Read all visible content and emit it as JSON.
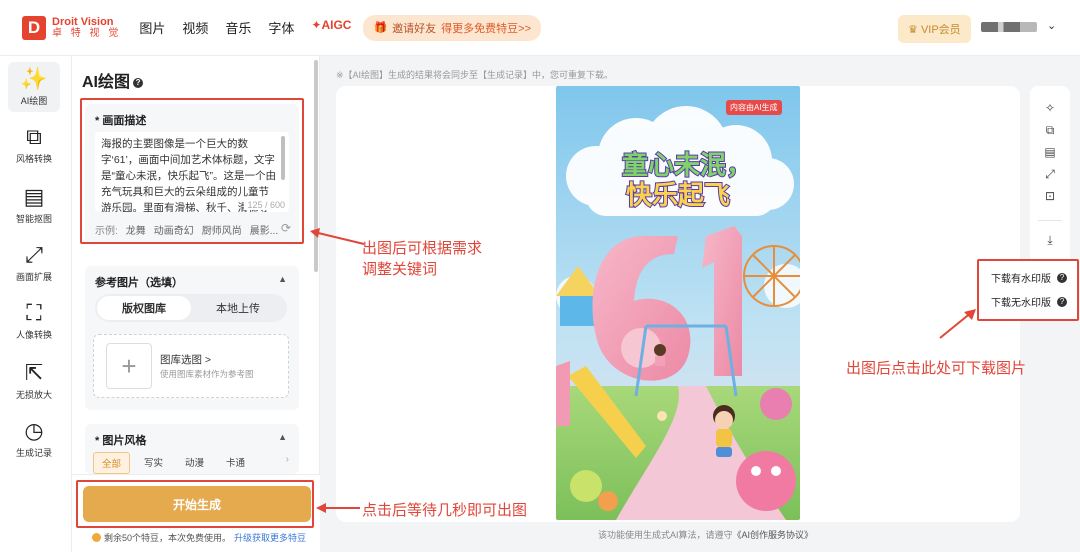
{
  "brand": {
    "en": "Droit Vision",
    "cn": "卓 特 视 觉"
  },
  "nav": {
    "items": [
      "图片",
      "视频",
      "音乐",
      "字体"
    ],
    "aigc": "AIGC"
  },
  "invite": {
    "label": "邀请好友",
    "highlight": "得更多免费特豆>>"
  },
  "account": {
    "vip": "VIP会员"
  },
  "sidebar": {
    "items": [
      {
        "label": "AI绘图",
        "icon": "magic-wand-icon"
      },
      {
        "label": "风格转换",
        "icon": "grid-shapes-icon"
      },
      {
        "label": "智能抠图",
        "icon": "layers-icon"
      },
      {
        "label": "画面扩展",
        "icon": "expand-icon"
      },
      {
        "label": "人像转换",
        "icon": "portrait-icon"
      },
      {
        "label": "无损放大",
        "icon": "upscale-icon"
      },
      {
        "label": "生成记录",
        "icon": "clock-icon"
      }
    ]
  },
  "panel": {
    "title": "AI绘图",
    "description": {
      "label": "* 画面描述",
      "text": "海报的主要图像是一个巨大的数字‘61’，画面中间加艺术体标题，文字是“童心未泯，快乐起飞”。这是一个由充气玩具和巨大的云朵组成的儿童节游乐园。里面有滑梯、秋千、滑梯等设施，",
      "count": "125 / 600",
      "examples_label": "示例:",
      "examples": [
        "龙舞",
        "动画奇幻",
        "厨师风尚",
        "晨影..."
      ]
    },
    "reference": {
      "label": "参考图片（选填）",
      "tabs": [
        "版权图库",
        "本地上传"
      ],
      "upload_title": "图库选图 >",
      "upload_sub": "使用图库素材作为参考图"
    },
    "style": {
      "label": "* 图片风格",
      "tabs": [
        "全部",
        "写实",
        "动漫",
        "卡通"
      ]
    },
    "generate": "开始生成",
    "remaining": "剩余50个特豆，本次免费使用。",
    "remaining_link": "升级获取更多特豆"
  },
  "main": {
    "notice": "※【AI绘图】生成的结果将会同步至【生成记录】中，您可重复下载。",
    "ai_badge": "内容由AI生成",
    "poster_title": [
      "童心未泯，",
      "快乐起飞"
    ],
    "poster_number": "61",
    "footer": "该功能使用生成式AI算法，请遵守",
    "footer_link": "《AI创作服务协议》",
    "download": [
      "下载有水印版",
      "下载无水印版"
    ]
  },
  "tools": [
    "magic-wand-icon",
    "grid-icon",
    "layers-icon",
    "expand-icon",
    "crop-icon",
    "download-icon"
  ],
  "annotations": {
    "a1": [
      "出图后可根据需求",
      "调整关键词"
    ],
    "a2": "点击后等待几秒即可出图",
    "a3": "出图后点击此处可下载图片"
  },
  "colors": {
    "accent": "#e5a94e",
    "brand": "#e5432f",
    "annotation": "#e0463a"
  }
}
